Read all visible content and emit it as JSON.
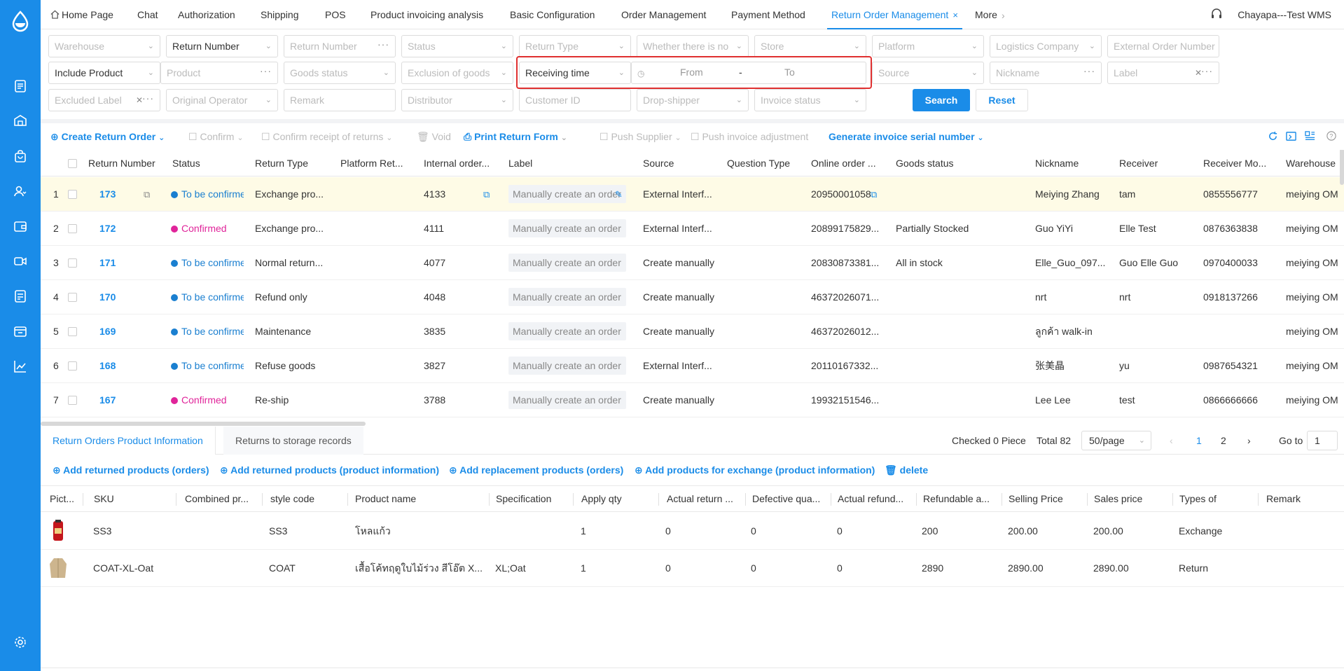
{
  "topbar": {
    "tabs": [
      "Home Page",
      "Chat",
      "Authorization",
      "Shipping",
      "POS",
      "Product invoicing analysis",
      "Basic Configuration",
      "Order Management",
      "Payment Method",
      "Return Order Management",
      "More"
    ],
    "active_tab": "Return Order Management",
    "close_glyph": "×",
    "user": "Chayapa---Test WMS"
  },
  "filters": {
    "warehouse": "Warehouse",
    "return_number_select": "Return Number",
    "return_number_input": "Return Number",
    "status": "Status",
    "return_type": "Return Type",
    "whether": "Whether there is no",
    "store": "Store",
    "platform": "Platform",
    "logistics": "Logistics Company",
    "external_order": "External Order Number",
    "include_product": "Include Product",
    "product": "Product",
    "goods_status": "Goods status",
    "exclusion": "Exclusion of goods",
    "receiving_time": "Receiving time",
    "from": "From",
    "range_sep": "-",
    "to": "To",
    "source": "Source",
    "nickname": "Nickname",
    "label": "Label",
    "excluded_label": "Excluded Label",
    "original_operator": "Original Operator",
    "remark": "Remark",
    "distributor": "Distributor",
    "customer_id": "Customer ID",
    "drop_shipper": "Drop-shipper",
    "invoice_status": "Invoice status",
    "search": "Search",
    "reset": "Reset"
  },
  "toolbar": {
    "create": "Create Return Order",
    "confirm": "Confirm",
    "confirm_receipt": "Confirm receipt of returns",
    "void": "Void",
    "print": "Print Return Form",
    "push_supplier": "Push Supplier",
    "push_invoice": "Push invoice adjustment",
    "generate_invoice": "Generate invoice serial number"
  },
  "grid": {
    "headers": [
      "Return Number",
      "Status",
      "Return Type",
      "Platform Ret...",
      "Internal order...",
      "Label",
      "Source",
      "Question Type",
      "Online order ...",
      "Goods status",
      "Nickname",
      "Receiver",
      "Receiver Mo...",
      "Warehouse"
    ],
    "rows": [
      {
        "idx": "1",
        "num": "173",
        "status": "To be confirmed",
        "status_color": "#1a7fd0",
        "type": "Exchange pro...",
        "internal": "4133",
        "label": "Manually create an order",
        "source": "External Interf...",
        "online": "20950001058",
        "goods": "",
        "nick": "Meiying Zhang",
        "receiver": "tam",
        "mobile": "0855556777",
        "wh": "meiying OM"
      },
      {
        "idx": "2",
        "num": "172",
        "status": "Confirmed",
        "status_color": "#e0249a",
        "type": "Exchange pro...",
        "internal": "4111",
        "label": "Manually create an order",
        "source": "External Interf...",
        "online": "20899175829...",
        "goods": "Partially Stocked",
        "nick": "Guo YiYi",
        "receiver": "Elle Test",
        "mobile": "0876363838",
        "wh": "meiying OM"
      },
      {
        "idx": "3",
        "num": "171",
        "status": "To be confirmed",
        "status_color": "#1a7fd0",
        "type": "Normal return...",
        "internal": "4077",
        "label": "Manually create an order",
        "source": "Create manually",
        "online": "20830873381...",
        "goods": "All in stock",
        "nick": "Elle_Guo_097...",
        "receiver": "Guo Elle Guo",
        "mobile": "0970400033",
        "wh": "meiying OM"
      },
      {
        "idx": "4",
        "num": "170",
        "status": "To be confirmed",
        "status_color": "#1a7fd0",
        "type": "Refund only",
        "internal": "4048",
        "label": "Manually create an order",
        "source": "Create manually",
        "online": "46372026071...",
        "goods": "",
        "nick": "nrt",
        "receiver": "nrt",
        "mobile": "0918137266",
        "wh": "meiying OM"
      },
      {
        "idx": "5",
        "num": "169",
        "status": "To be confirmed",
        "status_color": "#1a7fd0",
        "type": "Maintenance",
        "internal": "3835",
        "label": "Manually create an order",
        "source": "Create manually",
        "online": "46372026012...",
        "goods": "",
        "nick": "ลูกค้า walk-in",
        "receiver": "",
        "mobile": "",
        "wh": "meiying OM"
      },
      {
        "idx": "6",
        "num": "168",
        "status": "To be confirmed",
        "status_color": "#1a7fd0",
        "type": "Refuse goods",
        "internal": "3827",
        "label": "Manually create an order",
        "source": "External Interf...",
        "online": "20110167332...",
        "goods": "",
        "nick": "张美晶",
        "receiver": "yu",
        "mobile": "0987654321",
        "wh": "meiying OM"
      },
      {
        "idx": "7",
        "num": "167",
        "status": "Confirmed",
        "status_color": "#e0249a",
        "type": "Re-ship",
        "internal": "3788",
        "label": "Manually create an order",
        "source": "Create manually",
        "online": "19932151546...",
        "goods": "",
        "nick": "Lee Lee",
        "receiver": "test",
        "mobile": "0866666666",
        "wh": "meiying OM"
      }
    ]
  },
  "bottom": {
    "tab1": "Return Orders Product Information",
    "tab2": "Returns to storage records",
    "checked": "Checked 0 Piece",
    "total": "Total 82",
    "page_size": "50/page",
    "page1": "1",
    "page2": "2",
    "goto": "Go to",
    "goto_val": "1",
    "add_returned_orders": "Add returned products (orders)",
    "add_returned_info": "Add returned products (product information)",
    "add_replacement": "Add replacement products (orders)",
    "add_exchange": "Add products for exchange (product information)",
    "delete": "delete"
  },
  "products": {
    "headers": [
      "Pict...",
      "SKU",
      "Combined pr...",
      "style code",
      "Product name",
      "Specification",
      "Apply qty",
      "Actual return ...",
      "Defective qua...",
      "Actual refund...",
      "Refundable a...",
      "Selling Price",
      "Sales price",
      "Types of",
      "Remark"
    ],
    "rows": [
      {
        "sku": "SS3",
        "combined": "",
        "style": "SS3",
        "name": "โหลแก้ว",
        "spec": "",
        "apply": "1",
        "actual_return": "0",
        "defective": "0",
        "actual_refund": "0",
        "refundable": "200",
        "selling": "200.00",
        "sales": "200.00",
        "type": "Exchange",
        "remark": ""
      },
      {
        "sku": "COAT-XL-Oat",
        "combined": "",
        "style": "COAT",
        "name": "เสื้อโค้ทฤดูใบไม้ร่วง สีโอ๊ต X...",
        "spec": "XL;Oat",
        "apply": "1",
        "actual_return": "0",
        "defective": "0",
        "actual_refund": "0",
        "refundable": "2890",
        "selling": "2890.00",
        "sales": "2890.00",
        "type": "Return",
        "remark": ""
      }
    ]
  },
  "colors": {
    "accent": "#1a8ce8",
    "sidebar": "#1a8ce8",
    "highlight": "#e03030",
    "confirmed": "#e0249a",
    "to_be_confirmed": "#1a7fd0",
    "selected_row": "#fefbe6"
  }
}
